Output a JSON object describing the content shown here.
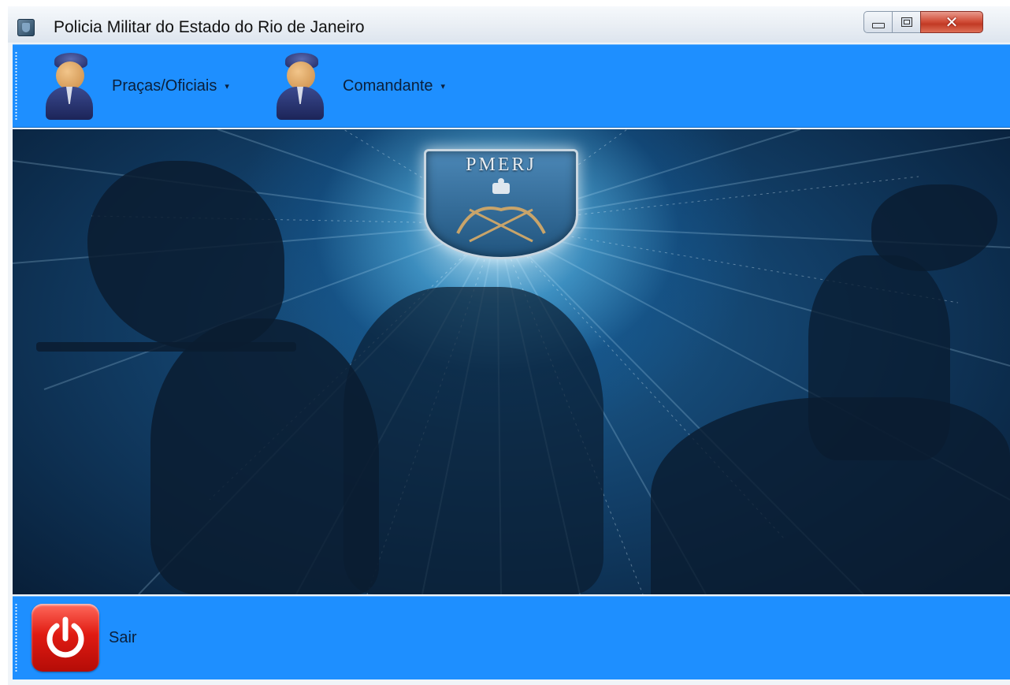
{
  "window": {
    "title": "Policia Militar do Estado do Rio de Janeiro"
  },
  "toolbar": {
    "menus": [
      {
        "label": "Praças/Oficiais",
        "icon": "officer-icon"
      },
      {
        "label": "Comandante",
        "icon": "commander-icon"
      }
    ],
    "caret": "▾"
  },
  "banner": {
    "emblem_text": "PMERJ",
    "emblem_icon": "pmerj-shield-emblem"
  },
  "footer": {
    "exit_label": "Sair",
    "exit_icon": "power-icon"
  },
  "colors": {
    "toolbar_bg": "#1e8fff",
    "banner_center": "#1c5f93",
    "banner_edge": "#071b33",
    "exit_button": "#e01b12"
  }
}
